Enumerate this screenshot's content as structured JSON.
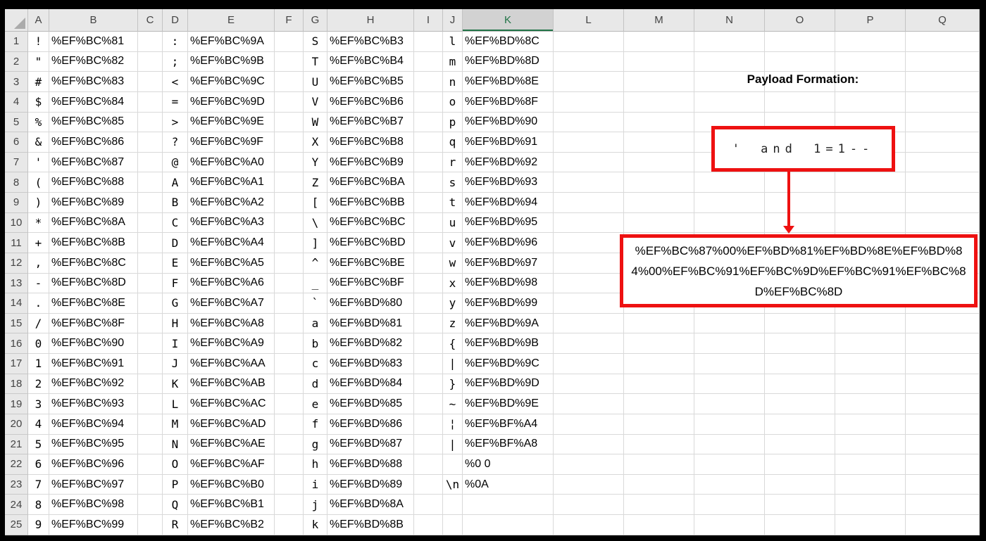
{
  "app": {
    "type": "spreadsheet"
  },
  "colors": {
    "annotation_red": "#EE1111",
    "selected_header_green": "#217346",
    "header_gray": "#E8E8E8"
  },
  "grid": {
    "selected_column": "K",
    "row_count": 25,
    "column_headers": [
      "A",
      "B",
      "C",
      "D",
      "E",
      "F",
      "G",
      "H",
      "I",
      "J",
      "K",
      "L",
      "M",
      "N",
      "O",
      "P",
      "Q"
    ],
    "columns": {
      "A": {
        "kind": "char",
        "values": [
          "!",
          "\"",
          "#",
          "$",
          "%",
          "&",
          "'",
          "(",
          ")",
          "*",
          "+",
          ",",
          "-",
          ".",
          "/",
          "0",
          "1",
          "2",
          "3",
          "4",
          "5",
          "6",
          "7",
          "8",
          "9"
        ]
      },
      "B": {
        "kind": "code",
        "values": [
          "%EF%BC%81",
          "%EF%BC%82",
          "%EF%BC%83",
          "%EF%BC%84",
          "%EF%BC%85",
          "%EF%BC%86",
          "%EF%BC%87",
          "%EF%BC%88",
          "%EF%BC%89",
          "%EF%BC%8A",
          "%EF%BC%8B",
          "%EF%BC%8C",
          "%EF%BC%8D",
          "%EF%BC%8E",
          "%EF%BC%8F",
          "%EF%BC%90",
          "%EF%BC%91",
          "%EF%BC%92",
          "%EF%BC%93",
          "%EF%BC%94",
          "%EF%BC%95",
          "%EF%BC%96",
          "%EF%BC%97",
          "%EF%BC%98",
          "%EF%BC%99"
        ]
      },
      "D": {
        "kind": "char",
        "values": [
          ":",
          ";",
          "<",
          "=",
          ">",
          "?",
          "@",
          "A",
          "B",
          "C",
          "D",
          "E",
          "F",
          "G",
          "H",
          "I",
          "J",
          "K",
          "L",
          "M",
          "N",
          "O",
          "P",
          "Q",
          "R"
        ]
      },
      "E": {
        "kind": "code",
        "values": [
          "%EF%BC%9A",
          "%EF%BC%9B",
          "%EF%BC%9C",
          "%EF%BC%9D",
          "%EF%BC%9E",
          "%EF%BC%9F",
          "%EF%BC%A0",
          "%EF%BC%A1",
          "%EF%BC%A2",
          "%EF%BC%A3",
          "%EF%BC%A4",
          "%EF%BC%A5",
          "%EF%BC%A6",
          "%EF%BC%A7",
          "%EF%BC%A8",
          "%EF%BC%A9",
          "%EF%BC%AA",
          "%EF%BC%AB",
          "%EF%BC%AC",
          "%EF%BC%AD",
          "%EF%BC%AE",
          "%EF%BC%AF",
          "%EF%BC%B0",
          "%EF%BC%B1",
          "%EF%BC%B2"
        ]
      },
      "G": {
        "kind": "char",
        "values": [
          "S",
          "T",
          "U",
          "V",
          "W",
          "X",
          "Y",
          "Z",
          "[",
          "\\",
          "]",
          "^",
          "_",
          "`",
          "a",
          "b",
          "c",
          "d",
          "e",
          "f",
          "g",
          "h",
          "i",
          "j",
          "k"
        ]
      },
      "H": {
        "kind": "code",
        "values": [
          "%EF%BC%B3",
          "%EF%BC%B4",
          "%EF%BC%B5",
          "%EF%BC%B6",
          "%EF%BC%B7",
          "%EF%BC%B8",
          "%EF%BC%B9",
          "%EF%BC%BA",
          "%EF%BC%BB",
          "%EF%BC%BC",
          "%EF%BC%BD",
          "%EF%BC%BE",
          "%EF%BC%BF",
          "%EF%BD%80",
          "%EF%BD%81",
          "%EF%BD%82",
          "%EF%BD%83",
          "%EF%BD%84",
          "%EF%BD%85",
          "%EF%BD%86",
          "%EF%BD%87",
          "%EF%BD%88",
          "%EF%BD%89",
          "%EF%BD%8A",
          "%EF%BD%8B"
        ]
      },
      "J": {
        "kind": "char",
        "values": [
          "l",
          "m",
          "n",
          "o",
          "p",
          "q",
          "r",
          "s",
          "t",
          "u",
          "v",
          "w",
          "x",
          "y",
          "z",
          "{",
          "|",
          "}",
          "~",
          "¦",
          "|",
          " ",
          "\\n",
          "",
          ""
        ]
      },
      "K": {
        "kind": "code",
        "values": [
          "%EF%BD%8C",
          "%EF%BD%8D",
          "%EF%BD%8E",
          "%EF%BD%8F",
          "%EF%BD%90",
          "%EF%BD%91",
          "%EF%BD%92",
          "%EF%BD%93",
          "%EF%BD%94",
          "%EF%BD%95",
          "%EF%BD%96",
          "%EF%BD%97",
          "%EF%BD%98",
          "%EF%BD%99",
          "%EF%BD%9A",
          "%EF%BD%9B",
          "%EF%BD%9C",
          "%EF%BD%9D",
          "%EF%BD%9E",
          "%EF%BF%A4",
          "%EF%BF%A8",
          "%0 0",
          "%0A",
          "",
          ""
        ]
      }
    }
  },
  "payload": {
    "title": "Payload Formation:",
    "input_display": "' and 1=1--",
    "encoded": "%EF%BC%87%00%EF%BD%81%EF%BD%8E%EF%BD%84%00%EF%BC%91%EF%BC%9D%EF%BC%91%EF%BC%8D%EF%BC%8D"
  }
}
